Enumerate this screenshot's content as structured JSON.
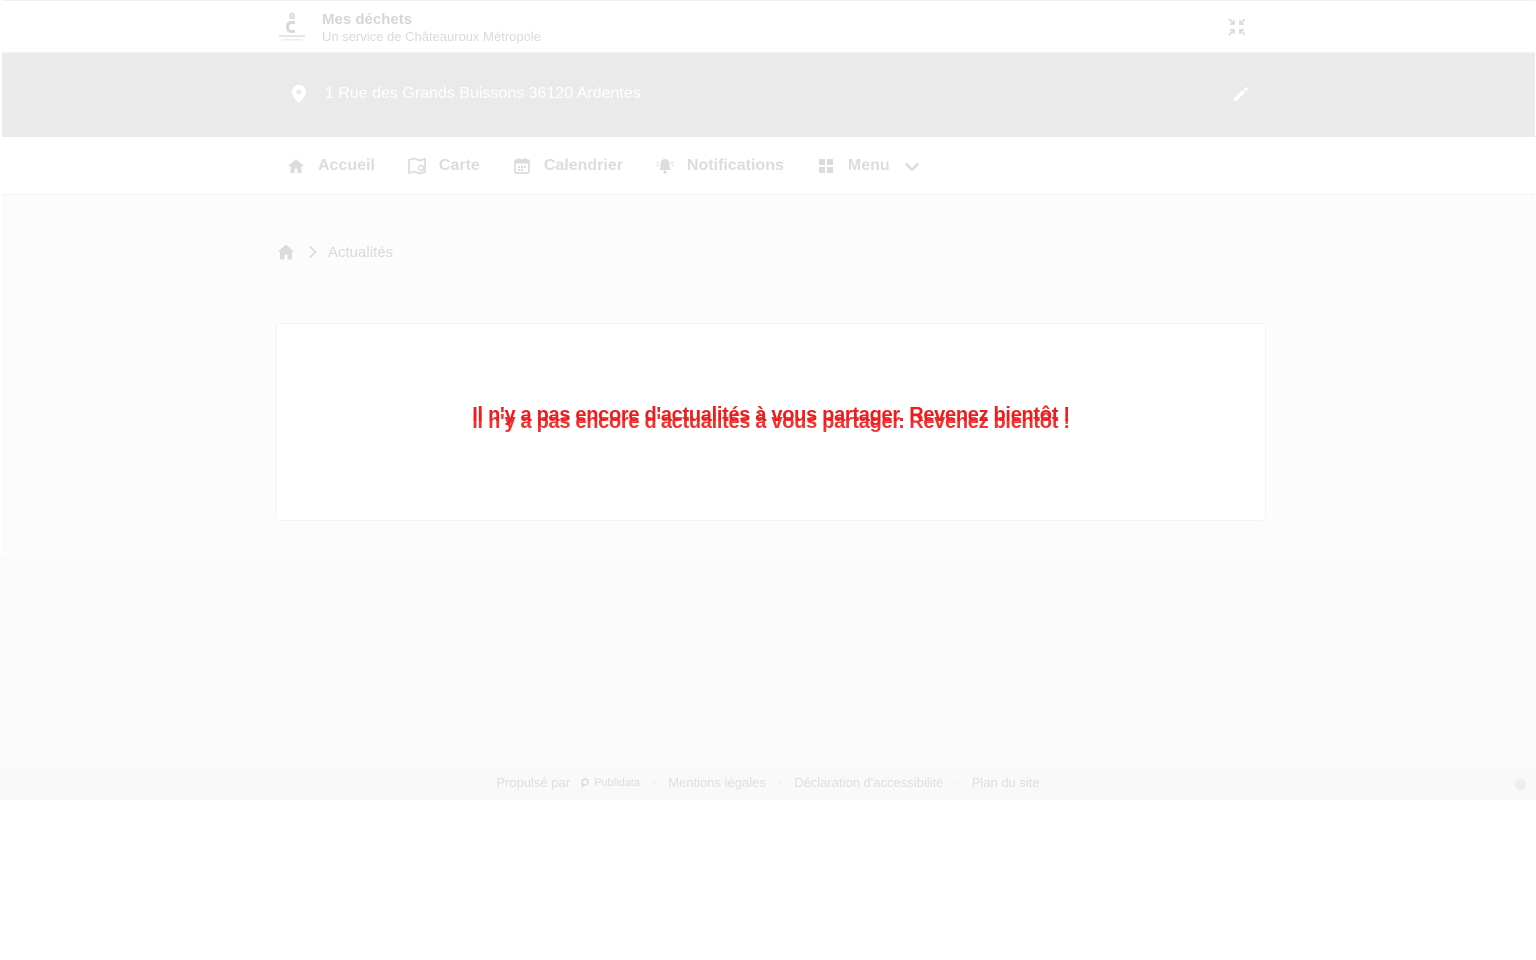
{
  "header": {
    "title": "Mes déchets",
    "subtitle": "Un service de Châteauroux Métropole",
    "logo_icon": "castle-logo-icon",
    "collapse_icon": "collapse-arrows-icon"
  },
  "address": {
    "value": "1 Rue des Grands Buissons 36120 Ardentes",
    "pin_icon": "map-pin-icon",
    "edit_icon": "pencil-icon"
  },
  "nav": {
    "items": [
      {
        "label": "Accueil",
        "icon": "home-icon"
      },
      {
        "label": "Carte",
        "icon": "map-icon"
      },
      {
        "label": "Calendrier",
        "icon": "calendar-icon"
      },
      {
        "label": "Notifications",
        "icon": "bell-alert-icon"
      },
      {
        "label": "Menu",
        "icon": "grid-icon"
      }
    ]
  },
  "breadcrumb": {
    "current": "Actualités"
  },
  "news": {
    "empty_message": "Il n'y a pas encore d'actualités à vous partager. Revenez bientôt !"
  },
  "footer": {
    "powered_by": "Propulsé par",
    "powered_brand": "Publidata",
    "links": [
      "Mentions légales",
      "Déclaration d'accessibilité",
      "Plan du site"
    ]
  },
  "colors": {
    "message": "#ee1c1c",
    "address_band": "#ebebeb",
    "muted_text": "#dcdcdc"
  }
}
